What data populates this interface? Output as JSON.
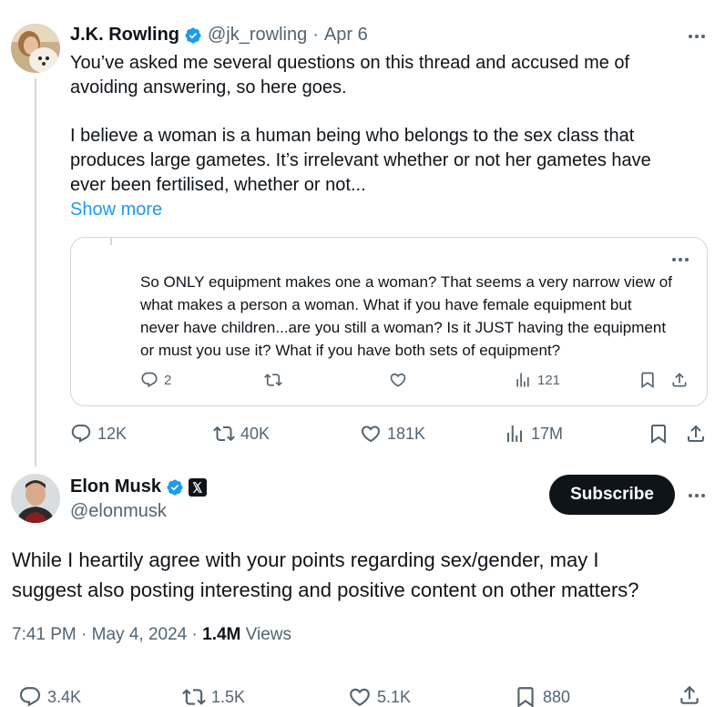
{
  "original_tweet": {
    "author_name": "J.K. Rowling",
    "handle": "@jk_rowling",
    "separator": "·",
    "date": "Apr 6",
    "text_line1": "You’ve asked me several questions on this thread and accused me of",
    "text_line2": "avoiding answering, so here goes.",
    "text_line3": "I believe a woman is a human being who belongs to the sex class that",
    "text_line4": "produces large gametes. It’s irrelevant whether or not her gametes have",
    "text_line5": "ever been fertilised, whether or not...",
    "show_more": "Show more",
    "quote": {
      "line1": "So ONLY equipment makes one a woman? That seems a very narrow view of",
      "line2": "what makes a person a woman. What if you have female equipment but",
      "line3": "never have children...are you still a woman? Is it JUST having the equipment",
      "line4": "or must you use it? What if you have both sets of equipment?",
      "replies": "2",
      "reposts": "",
      "likes": "",
      "views": "121"
    },
    "replies": "12K",
    "reposts": "40K",
    "likes": "181K",
    "views": "17M"
  },
  "reply_tweet": {
    "author_name": "Elon Musk",
    "handle": "@elonmusk",
    "subscribe_label": "Subscribe",
    "text_line1": "While I heartily agree with your points regarding sex/gender, may I",
    "text_line2": "suggest also posting interesting and positive content on other matters?",
    "time": "7:41 PM",
    "separator": "·",
    "date": "May 4, 2024",
    "separator2": "·",
    "views_count": "1.4M",
    "views_label": "Views",
    "replies": "3.4K",
    "reposts": "1.5K",
    "likes": "5.1K",
    "bookmarks": "880"
  },
  "colors": {
    "accent": "#1d9bf0",
    "text": "#0f1419",
    "muted": "#536471",
    "border": "#cfd9de",
    "button": "#0f1419"
  },
  "icons": [
    "more-icon",
    "verified-icon",
    "reply-icon",
    "repost-icon",
    "like-icon",
    "views-icon",
    "bookmark-icon",
    "share-icon",
    "x-logo-icon"
  ]
}
